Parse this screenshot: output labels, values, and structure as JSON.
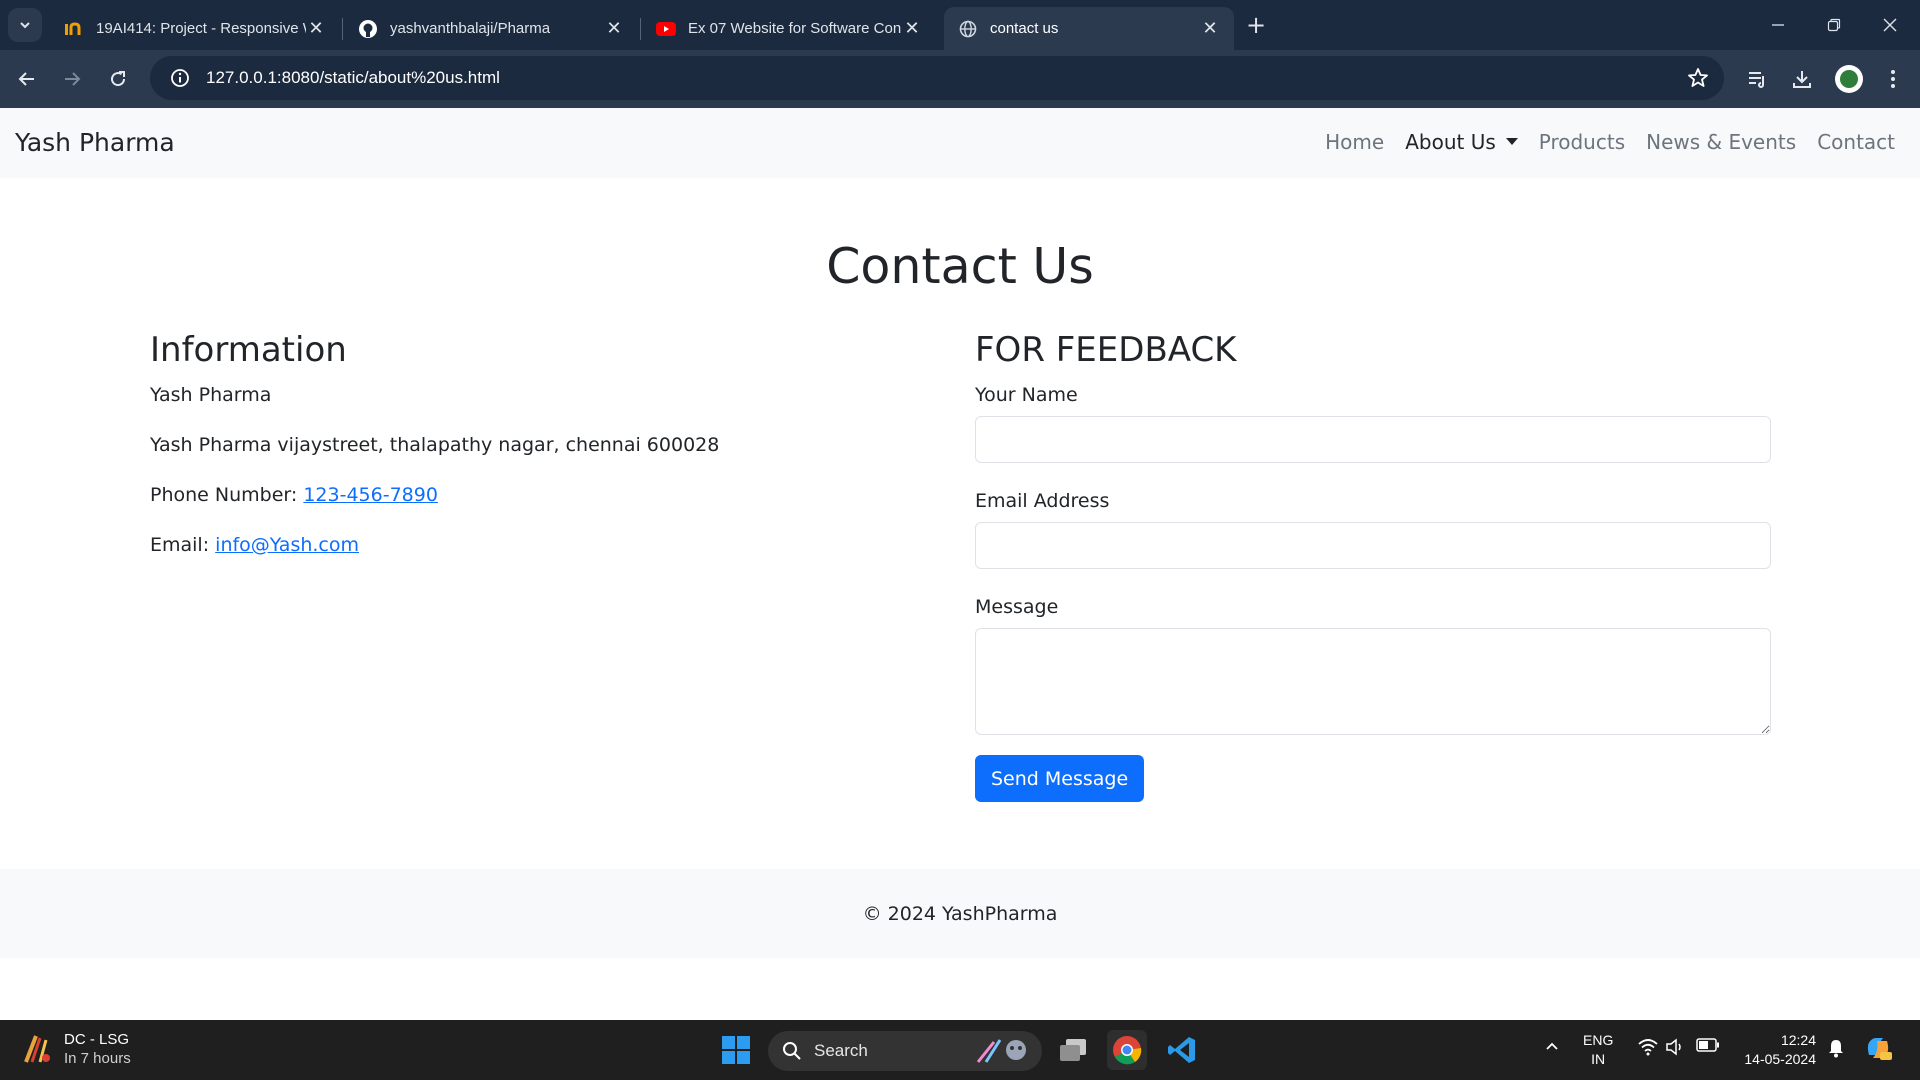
{
  "browser": {
    "tabs": [
      {
        "title": "19AI414: Project - Responsive W",
        "icon": "inshorts-icon",
        "active": false
      },
      {
        "title": "yashvanthbalaji/Pharma",
        "icon": "github-icon",
        "active": false
      },
      {
        "title": "Ex 07 Website for Software Con",
        "icon": "youtube-icon",
        "active": false
      },
      {
        "title": "contact us",
        "icon": "globe-icon",
        "active": true
      }
    ],
    "url": "127.0.0.1:8080/static/about%20us.html"
  },
  "site": {
    "brand": "Yash Pharma",
    "nav": {
      "home": "Home",
      "about": "About Us",
      "products": "Products",
      "news": "News & Events",
      "contact": "Contact"
    },
    "page_title": "Contact Us",
    "information": {
      "heading": "Information",
      "company": "Yash Pharma",
      "address": "Yash Pharma vijaystreet, thalapathy nagar, chennai 600028",
      "phone_label": "Phone Number:",
      "phone": "123-456-7890",
      "email_label": "Email:",
      "email": "info@Yash.com"
    },
    "feedback": {
      "heading": "FOR FEEDBACK",
      "name_label": "Your Name",
      "name_value": "",
      "email_label": "Email Address",
      "email_value": "",
      "message_label": "Message",
      "message_value": "",
      "submit_label": "Send Message"
    },
    "footer": "© 2024 YashPharma"
  },
  "taskbar": {
    "weather_title": "DC - LSG",
    "weather_sub": "In 7 hours",
    "search_label": "Search",
    "lang_line1": "ENG",
    "lang_line2": "IN",
    "time": "12:24",
    "date": "14-05-2024"
  },
  "colors": {
    "primary": "#0d6efd",
    "navbar_bg": "#f8f9fa",
    "chrome_dark": "#1b2a3e",
    "chrome_toolbar": "#2b3a4f",
    "taskbar": "#1f1f1f"
  }
}
